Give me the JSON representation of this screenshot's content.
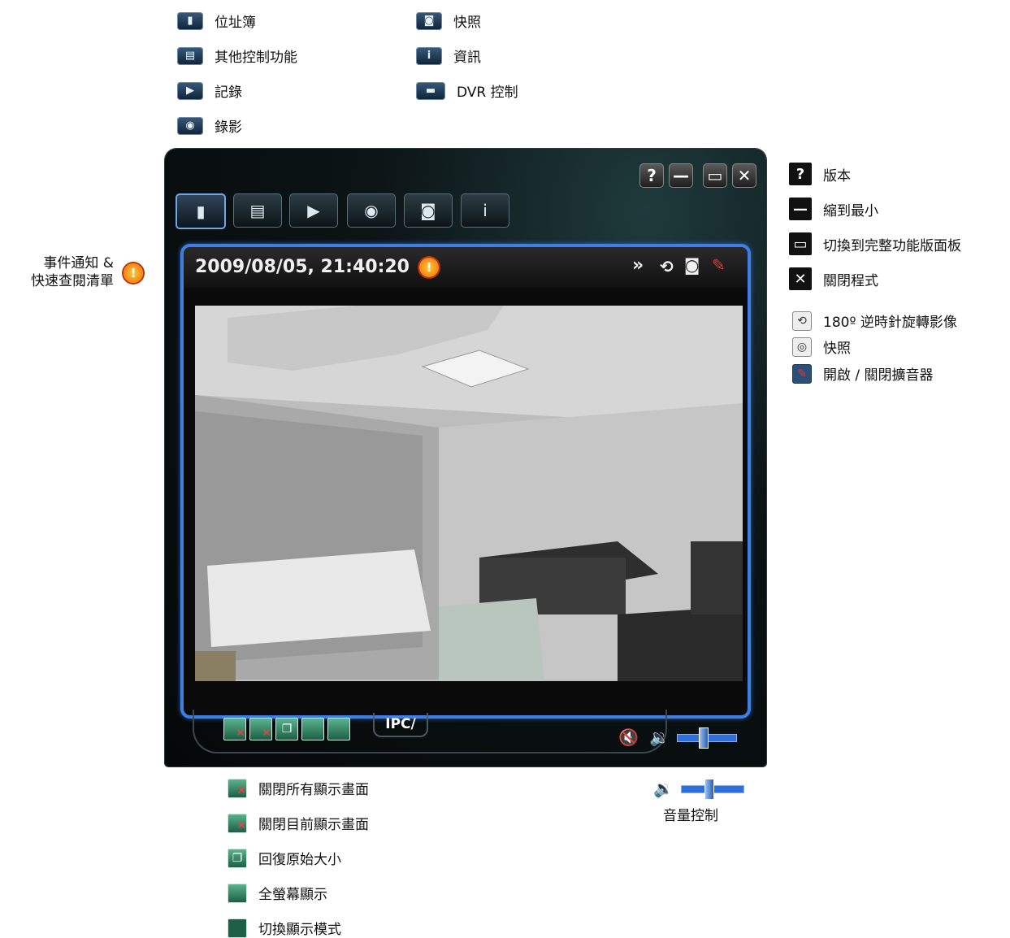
{
  "top_legend": {
    "left": [
      {
        "icon": "address-book-icon",
        "label": "位址簿"
      },
      {
        "icon": "other-controls-icon",
        "label": "其他控制功能"
      },
      {
        "icon": "log-icon",
        "label": "記錄"
      },
      {
        "icon": "record-icon",
        "label": "錄影"
      }
    ],
    "right": [
      {
        "icon": "snapshot-icon",
        "label": "快照"
      },
      {
        "icon": "info-icon",
        "label": "資訊"
      },
      {
        "icon": "dvr-control-icon",
        "label": "DVR 控制"
      }
    ]
  },
  "left_annotation": {
    "line1": "事件通知 &",
    "line2": "快速查閱清單"
  },
  "right_legend": [
    {
      "icon": "question-icon",
      "glyph": "?",
      "label": "版本"
    },
    {
      "icon": "minimize-icon",
      "glyph": "—",
      "label": "縮到最小"
    },
    {
      "icon": "maximize-icon",
      "glyph": "▭",
      "label": "切換到完整功能版面板"
    },
    {
      "icon": "close-icon",
      "glyph": "✕",
      "label": "關閉程式"
    },
    {
      "icon": "rotate-icon",
      "glyph": "⟲",
      "label": "180º 逆時針旋轉影像"
    },
    {
      "icon": "camera-icon",
      "glyph": "◎",
      "label": "快照"
    },
    {
      "icon": "speaker-toggle-icon",
      "glyph": "✎",
      "label": "開啟 / 關閉擴音器"
    }
  ],
  "viewer": {
    "timestamp": "2009/08/05, 21:40:20",
    "ipc_label": "IPC/"
  },
  "bottom_legend": [
    {
      "icon": "close-all-displays-icon",
      "label": "關閉所有顯示畫面"
    },
    {
      "icon": "close-current-display-icon",
      "label": "關閉目前顯示畫面"
    },
    {
      "icon": "restore-size-icon",
      "label": "回復原始大小"
    },
    {
      "icon": "fullscreen-icon",
      "label": "全螢幕顯示"
    },
    {
      "icon": "switch-display-mode-icon",
      "label": "切換顯示模式"
    }
  ],
  "volume": {
    "label": "音量控制",
    "level": 0.45
  }
}
